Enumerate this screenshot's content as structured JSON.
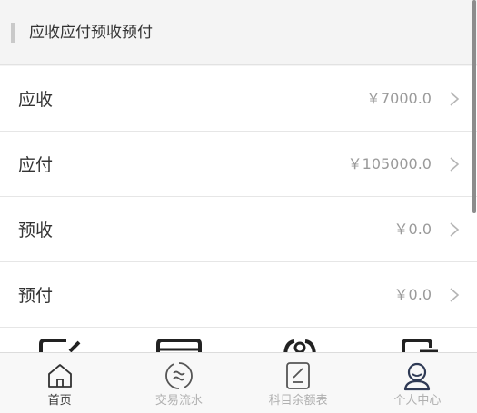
{
  "section": {
    "title": "应收应付预收预付"
  },
  "rows": [
    {
      "label": "应收",
      "amount": "￥7000.0"
    },
    {
      "label": "应付",
      "amount": "￥105000.0"
    },
    {
      "label": "预收",
      "amount": "￥0.0"
    },
    {
      "label": "预付",
      "amount": "￥0.0"
    }
  ],
  "tabs": [
    {
      "label": "首页",
      "icon": "home-icon",
      "active": true
    },
    {
      "label": "交易流水",
      "icon": "exchange-icon",
      "active": false
    },
    {
      "label": "科目余额表",
      "icon": "ledger-icon",
      "active": false
    },
    {
      "label": "个人中心",
      "icon": "user-icon",
      "active": false
    }
  ],
  "colors": {
    "active_tab": "#333333",
    "inactive_tab": "#b0b0b0",
    "amount": "#9a9a9a",
    "user_icon": "#2f3a55"
  }
}
